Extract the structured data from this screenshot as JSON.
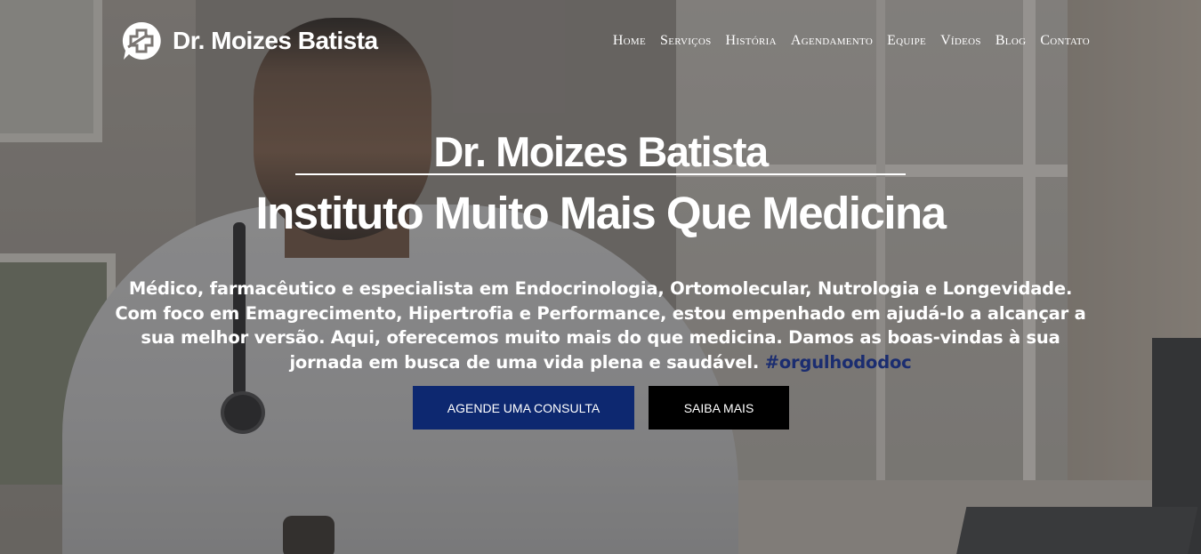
{
  "brand": {
    "name": "Dr. Moizes Batista",
    "icon": "medical-cross-chat-icon"
  },
  "nav": {
    "items": [
      {
        "label": "Home"
      },
      {
        "label": "Serviços"
      },
      {
        "label": "História"
      },
      {
        "label": "Agendamento"
      },
      {
        "label": "Equipe"
      },
      {
        "label": "Vídeos"
      },
      {
        "label": "Blog"
      },
      {
        "label": "Contato"
      }
    ]
  },
  "hero": {
    "title": "Dr. Moizes Batista",
    "subtitle": "Instituto Muito Mais Que Medicina",
    "description": "Médico, farmacêutico e especialista em Endocrinologia, Ortomolecular, Nutrologia e Longevidade. Com foco em Emagrecimento, Hipertrofia e Performance, estou empenhado em ajudá-lo a alcançar a sua melhor versão. Aqui, oferecemos muito mais do que medicina. Damos as boas-vindas à sua jornada em busca de uma vida plena e saudável.",
    "hashtag": "#orgulhododoc",
    "primary_button": "AGENDE UMA CONSULTA",
    "secondary_button": "SAIBA MAIS"
  },
  "colors": {
    "primary_button": "#0d2870",
    "secondary_button": "#000000",
    "hashtag": "#1b2d70",
    "text": "#ffffff"
  }
}
